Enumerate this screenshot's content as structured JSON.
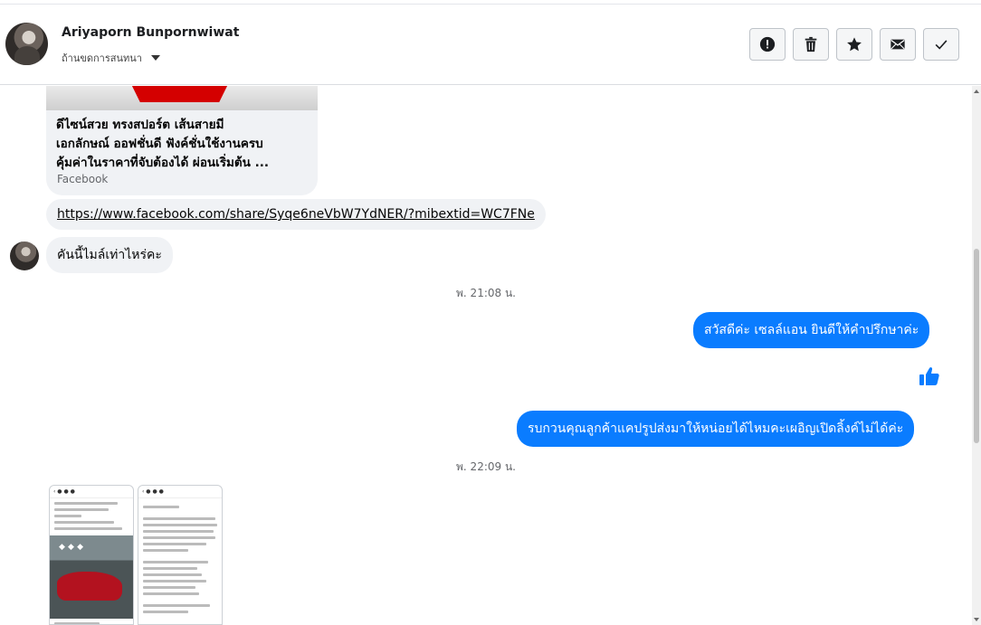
{
  "contact": {
    "name": "Ariyaporn Bunpornwiwat",
    "subtitle": "ถ้านขดการสนทนา"
  },
  "actions": [
    {
      "name": "report",
      "icon": "exclamation-icon"
    },
    {
      "name": "delete",
      "icon": "trash-icon"
    },
    {
      "name": "star",
      "icon": "star-icon"
    },
    {
      "name": "mark-unread",
      "icon": "envelope-icon"
    },
    {
      "name": "done",
      "icon": "check-icon"
    }
  ],
  "messages": {
    "link_card": {
      "title": "ดีไซน์สวย ทรงสปอร์ต เส้นสายมี\nเอกลักษณ์ ออฟชั่นดี ฟังค์ชั่นใช้งานครบ\nคุ้มค่าในราคาที่จับต้องได้ ผ่อนเริ่มต้น ...",
      "source": "Facebook"
    },
    "link_url": "https://www.facebook.com/share/Syqe6neVbW7YdNER/?mibextid=WC7FNe",
    "incoming_question": "คันนี้ไมล์เท่าไหร่คะ",
    "timestamp_1": "พ. 21:08 น.",
    "outgoing_greeting": "สวัสดีค่ะ เซลล์แอน ยินดีให้คำปรึกษาค่ะ",
    "like_icon": "thumbs-up-icon",
    "outgoing_request": "รบกวนคุณลูกค้าแคปรูปส่งมาให้หน่อยได้ไหมคะเผอิญเปิดลิ้งค์ไม่ได้ค่ะ",
    "timestamp_2": "พ. 22:09 น."
  },
  "colors": {
    "accent": "#0a7cff",
    "incoming_bubble": "#f0f2f5"
  }
}
